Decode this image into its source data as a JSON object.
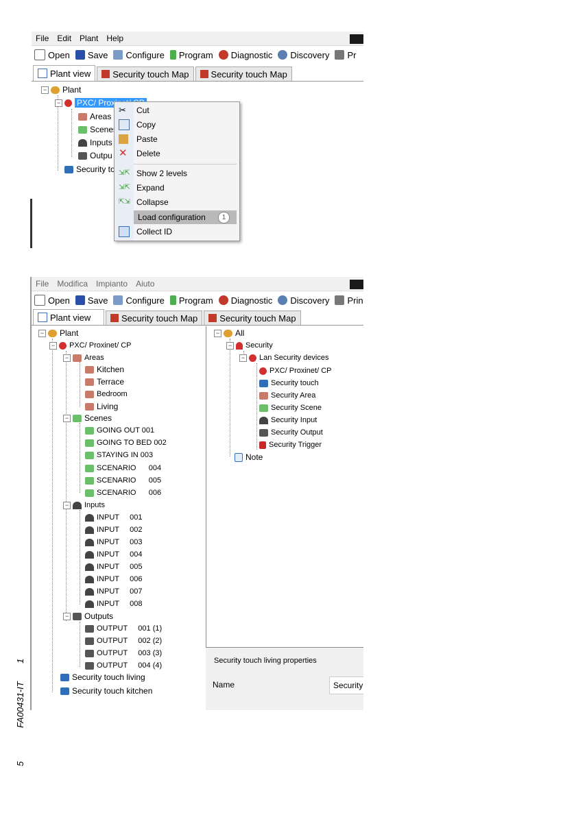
{
  "top": {
    "menu": [
      "File",
      "Edit",
      "Plant",
      "Help"
    ],
    "toolbar": [
      "Open",
      "Save",
      "Configure",
      "Program",
      "Diagnostic",
      "Discovery",
      "Pr"
    ],
    "tabs": [
      "Plant view",
      "Security touch Map",
      "Security touch Map"
    ],
    "tree": {
      "plant": "Plant",
      "device": "PXC/ Proxinet/ CP",
      "areas": "Areas",
      "scenes": "Scenes",
      "inputs": "Inputs",
      "outputs": "Outpu",
      "touch": "Security to"
    },
    "context_menu": {
      "cut": "Cut",
      "copy": "Copy",
      "paste": "Paste",
      "delete": "Delete",
      "show_levels": "Show 2 levels",
      "expand": "Expand",
      "collapse": "Collapse",
      "load_config": "Load configuration",
      "collect_id": "Collect ID",
      "callout": "1"
    }
  },
  "bottom": {
    "menu": [
      "File",
      "Modifica",
      "Impianto",
      "Aiuto"
    ],
    "toolbar": [
      "Open",
      "Save",
      "Configure",
      "Program",
      "Diagnostic",
      "Discovery",
      "Print"
    ],
    "tabs": [
      "Plant view",
      "Security touch Map",
      "Security touch Map"
    ],
    "left_tree": {
      "plant": "Plant",
      "device": "PXC/ Proxinet/ CP",
      "areas": "Areas",
      "area_items": [
        "Kitchen",
        "Terrace",
        "Bedroom",
        "Living"
      ],
      "scenes": "Scenes",
      "scene_items": [
        "GOING OUT 001",
        "GOING TO BED 002",
        "STAYING IN 003",
        "SCENARIO      004",
        "SCENARIO      005",
        "SCENARIO      006"
      ],
      "inputs": "Inputs",
      "input_items": [
        "INPUT     001",
        "INPUT     002",
        "INPUT     003",
        "INPUT     004",
        "INPUT     005",
        "INPUT     006",
        "INPUT     007",
        "INPUT     008"
      ],
      "outputs": "Outputs",
      "output_items": [
        "OUTPUT     001 (1)",
        "OUTPUT     002 (2)",
        "OUTPUT     003 (3)",
        "OUTPUT     004 (4)"
      ],
      "touch_items": [
        "Security touch living",
        "Security touch kitchen"
      ]
    },
    "right_tree": {
      "all": "All",
      "security": "Security",
      "lan": "Lan Security devices",
      "items": [
        "PXC/ Proxinet/ CP",
        "Security touch",
        "Security Area",
        "Security Scene",
        "Security Input",
        "Security Output",
        "Security Trigger"
      ],
      "note": "Note"
    },
    "properties": {
      "title": "Security touch living properties",
      "name_label": "Name",
      "name_value": "Security t"
    }
  },
  "margin": {
    "code": "FA00431-IT",
    "one": "1",
    "five": "5"
  },
  "colors": {
    "selection": "#3399ff",
    "highlight": "#b9b9b9",
    "tree_line": "#888888"
  }
}
